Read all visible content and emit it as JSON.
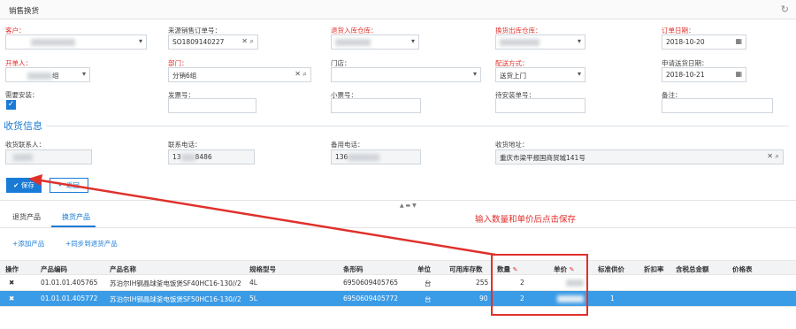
{
  "window": {
    "title": "销售换货"
  },
  "form": {
    "customer_label": "客户：",
    "source_order_label": "来源销售订单号：",
    "source_order_value": "SO1809140227",
    "return_wh_label": "退货入库仓库：",
    "exchange_wh_label": "换货出库仓库：",
    "order_date_label": "订单日期：",
    "order_date_value": "2018-10-20",
    "creator_label": "开单人：",
    "creator_suffix": "组",
    "dept_label": "部门：",
    "dept_value": "分销6组",
    "store_label": "门店：",
    "delivery_label": "配送方式：",
    "delivery_value": "送货上门",
    "apply_date_label": "申请送货日期：",
    "apply_date_value": "2018-10-21",
    "install_label": "需要安装：",
    "invoice_label": "发票号：",
    "ticket_label": "小票号：",
    "pending_install_label": "待安装单号：",
    "remark_label": "备注："
  },
  "receipt": {
    "section_title": "收货信息",
    "contact_label": "收货联系人：",
    "phone_label": "联系电话：",
    "phone_prefix": "13",
    "phone_suffix": "8486",
    "alt_phone_label": "备用电话：",
    "alt_phone_prefix": "136",
    "alt_phone_suffix": "",
    "address_label": "收货地址：",
    "address_value": "重庆市梁平报国商贸城141号"
  },
  "actions": {
    "save": "保存",
    "back": "返回"
  },
  "tabs": [
    {
      "label": "退货产品"
    },
    {
      "label": "换货产品"
    }
  ],
  "toolbar": {
    "add": "+添加产品",
    "sync": "+同步到退货产品"
  },
  "annotation": "输入数量和单价后点击保存",
  "grid": {
    "headers": [
      "操作",
      "产品编码",
      "产品名称",
      "规格型号",
      "条形码",
      "单位",
      "可用库存数",
      "数量",
      "单价",
      "标准供价",
      "折扣率",
      "含税总金额",
      "价格表"
    ],
    "rows": [
      {
        "op": "✖",
        "code": "01.01.01.405765",
        "name": "苏泊尔IH钢晶球釜电饭煲SF40HC16-130//2",
        "spec": "4L",
        "barcode": "6950609405765",
        "unit": "台",
        "stock": "255",
        "qty": "2",
        "std": ""
      },
      {
        "op": "✖",
        "code": "01.01.01.405772",
        "name": "苏泊尔IH钢晶球釜电饭煲SF50HC16-130//2",
        "spec": "5L",
        "barcode": "6950609405772",
        "unit": "台",
        "stock": "90",
        "qty": "2",
        "std": "1"
      }
    ]
  },
  "icons": {
    "refresh": "refresh-icon",
    "search": "search-icon",
    "clear": "clear-icon",
    "calendar": "calendar-icon",
    "dropdown": "chevron-down-icon",
    "edit": "edit-icon"
  },
  "colors": {
    "accent": "#1a7bd6",
    "required": "#e0302b",
    "selected_row": "#3a9be6"
  }
}
